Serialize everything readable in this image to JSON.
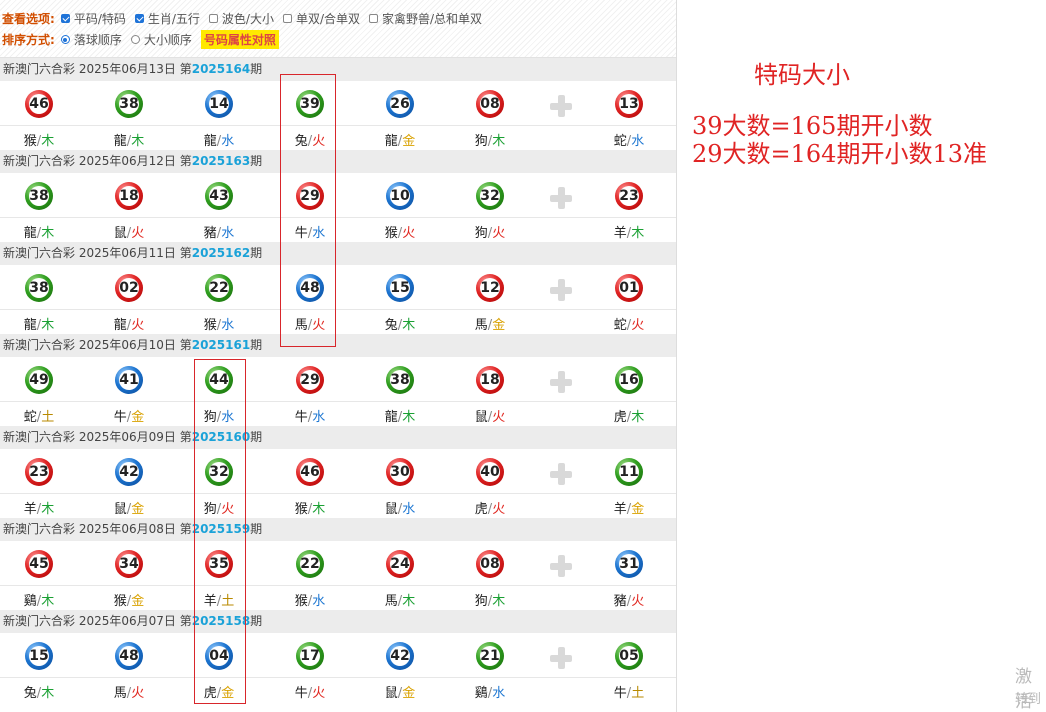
{
  "options": {
    "view_label": "查看选项:",
    "view_items": [
      {
        "label": "平码/特码",
        "checked": true
      },
      {
        "label": "生肖/五行",
        "checked": true
      },
      {
        "label": "波色/大小",
        "checked": false
      },
      {
        "label": "单双/合单双",
        "checked": false
      },
      {
        "label": "家禽野兽/总和单双",
        "checked": false
      }
    ],
    "sort_label": "排序方式:",
    "sort_items": [
      {
        "label": "落球顺序",
        "checked": true
      },
      {
        "label": "大小顺序",
        "checked": false
      }
    ],
    "compare_button": "号码属性对照"
  },
  "draws": [
    {
      "prefix": "新澳门六合彩 2025年06月13日 第",
      "issue": "2025164",
      "suffix": "期",
      "balls": [
        {
          "num": "46",
          "color": "red",
          "zodiac": "猴",
          "element": "木"
        },
        {
          "num": "38",
          "color": "green",
          "zodiac": "龍",
          "element": "木"
        },
        {
          "num": "14",
          "color": "blue",
          "zodiac": "龍",
          "element": "水"
        },
        {
          "num": "39",
          "color": "green",
          "zodiac": "兔",
          "element": "火"
        },
        {
          "num": "26",
          "color": "blue",
          "zodiac": "龍",
          "element": "金"
        },
        {
          "num": "08",
          "color": "red",
          "zodiac": "狗",
          "element": "木"
        },
        {
          "num": "13",
          "color": "red",
          "zodiac": "蛇",
          "element": "水"
        }
      ]
    },
    {
      "prefix": "新澳门六合彩 2025年06月12日 第",
      "issue": "2025163",
      "suffix": "期",
      "balls": [
        {
          "num": "38",
          "color": "green",
          "zodiac": "龍",
          "element": "木"
        },
        {
          "num": "18",
          "color": "red",
          "zodiac": "鼠",
          "element": "火"
        },
        {
          "num": "43",
          "color": "green",
          "zodiac": "豬",
          "element": "水"
        },
        {
          "num": "29",
          "color": "red",
          "zodiac": "牛",
          "element": "水"
        },
        {
          "num": "10",
          "color": "blue",
          "zodiac": "猴",
          "element": "火"
        },
        {
          "num": "32",
          "color": "green",
          "zodiac": "狗",
          "element": "火"
        },
        {
          "num": "23",
          "color": "red",
          "zodiac": "羊",
          "element": "木"
        }
      ]
    },
    {
      "prefix": "新澳门六合彩 2025年06月11日 第",
      "issue": "2025162",
      "suffix": "期",
      "balls": [
        {
          "num": "38",
          "color": "green",
          "zodiac": "龍",
          "element": "木"
        },
        {
          "num": "02",
          "color": "red",
          "zodiac": "龍",
          "element": "火"
        },
        {
          "num": "22",
          "color": "green",
          "zodiac": "猴",
          "element": "水"
        },
        {
          "num": "48",
          "color": "blue",
          "zodiac": "馬",
          "element": "火"
        },
        {
          "num": "15",
          "color": "blue",
          "zodiac": "兔",
          "element": "木"
        },
        {
          "num": "12",
          "color": "red",
          "zodiac": "馬",
          "element": "金"
        },
        {
          "num": "01",
          "color": "red",
          "zodiac": "蛇",
          "element": "火"
        }
      ]
    },
    {
      "prefix": "新澳门六合彩 2025年06月10日 第",
      "issue": "2025161",
      "suffix": "期",
      "balls": [
        {
          "num": "49",
          "color": "green",
          "zodiac": "蛇",
          "element": "土"
        },
        {
          "num": "41",
          "color": "blue",
          "zodiac": "牛",
          "element": "金"
        },
        {
          "num": "44",
          "color": "green",
          "zodiac": "狗",
          "element": "水"
        },
        {
          "num": "29",
          "color": "red",
          "zodiac": "牛",
          "element": "水"
        },
        {
          "num": "38",
          "color": "green",
          "zodiac": "龍",
          "element": "木"
        },
        {
          "num": "18",
          "color": "red",
          "zodiac": "鼠",
          "element": "火"
        },
        {
          "num": "16",
          "color": "green",
          "zodiac": "虎",
          "element": "木"
        }
      ]
    },
    {
      "prefix": "新澳门六合彩 2025年06月09日 第",
      "issue": "2025160",
      "suffix": "期",
      "balls": [
        {
          "num": "23",
          "color": "red",
          "zodiac": "羊",
          "element": "木"
        },
        {
          "num": "42",
          "color": "blue",
          "zodiac": "鼠",
          "element": "金"
        },
        {
          "num": "32",
          "color": "green",
          "zodiac": "狗",
          "element": "火"
        },
        {
          "num": "46",
          "color": "red",
          "zodiac": "猴",
          "element": "木"
        },
        {
          "num": "30",
          "color": "red",
          "zodiac": "鼠",
          "element": "水"
        },
        {
          "num": "40",
          "color": "red",
          "zodiac": "虎",
          "element": "火"
        },
        {
          "num": "11",
          "color": "green",
          "zodiac": "羊",
          "element": "金"
        }
      ]
    },
    {
      "prefix": "新澳门六合彩 2025年06月08日 第",
      "issue": "2025159",
      "suffix": "期",
      "balls": [
        {
          "num": "45",
          "color": "red",
          "zodiac": "鷄",
          "element": "木"
        },
        {
          "num": "34",
          "color": "red",
          "zodiac": "猴",
          "element": "金"
        },
        {
          "num": "35",
          "color": "red",
          "zodiac": "羊",
          "element": "土"
        },
        {
          "num": "22",
          "color": "green",
          "zodiac": "猴",
          "element": "水"
        },
        {
          "num": "24",
          "color": "red",
          "zodiac": "馬",
          "element": "木"
        },
        {
          "num": "08",
          "color": "red",
          "zodiac": "狗",
          "element": "木"
        },
        {
          "num": "31",
          "color": "blue",
          "zodiac": "豬",
          "element": "火"
        }
      ]
    },
    {
      "prefix": "新澳门六合彩 2025年06月07日 第",
      "issue": "2025158",
      "suffix": "期",
      "balls": [
        {
          "num": "15",
          "color": "blue",
          "zodiac": "兔",
          "element": "木"
        },
        {
          "num": "48",
          "color": "blue",
          "zodiac": "馬",
          "element": "火"
        },
        {
          "num": "04",
          "color": "blue",
          "zodiac": "虎",
          "element": "金"
        },
        {
          "num": "17",
          "color": "green",
          "zodiac": "牛",
          "element": "火"
        },
        {
          "num": "42",
          "color": "blue",
          "zodiac": "鼠",
          "element": "金"
        },
        {
          "num": "21",
          "color": "green",
          "zodiac": "鷄",
          "element": "水"
        },
        {
          "num": "05",
          "color": "green",
          "zodiac": "牛",
          "element": "土"
        }
      ]
    }
  ],
  "annotation": {
    "title": "特码大小",
    "lines": [
      "39大数=165期开小数",
      "29大数=164期开小数13准"
    ]
  },
  "watermark": {
    "line1": "激活",
    "line2": "转到"
  },
  "colors": {
    "red": "#e02424",
    "blue": "#1c74d0",
    "green": "#2f9e1f",
    "issue": "#1ba2d8",
    "option_label": "#d14e00",
    "highlight": "#d8262b"
  }
}
